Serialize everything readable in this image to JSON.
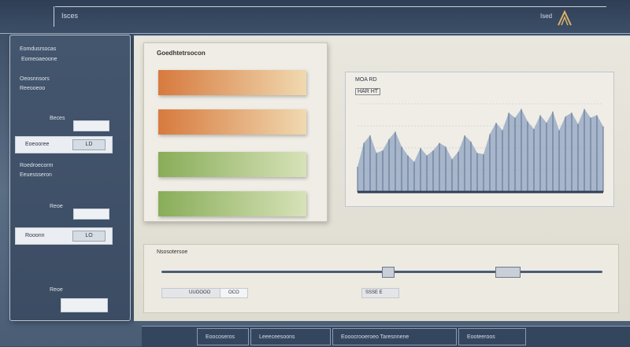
{
  "header": {
    "title": "Isces",
    "user": "Ised"
  },
  "sidebar": {
    "title1": "Eomdusrsocas",
    "title2": "Eomeoaeoone",
    "sub1": "Oeosnnsors",
    "sub2": "Reeooeoo",
    "field1_label": "Beces",
    "row1": {
      "label": "Eoeooree",
      "button": "LD"
    },
    "title3": "Roedroecorm",
    "sub3": "Eeuessseron",
    "field2_label": "Reoe",
    "row2": {
      "label": "Rooonn",
      "button": "LO"
    },
    "field3_label": "Reoe"
  },
  "main": {
    "panel_title": "Goedhtetrsocon",
    "bars": [
      {
        "color": "orange"
      },
      {
        "color": "orange"
      },
      {
        "color": "green"
      },
      {
        "color": "green"
      }
    ],
    "chart_label1": "MOA RD",
    "chart_label2": "HAR HT"
  },
  "lower": {
    "title": "Nsosotersoe",
    "field1": "UUOOOO",
    "field2": "OCO",
    "field3": "SSSE E"
  },
  "footer": {
    "tabs": [
      "Eoocoseros",
      "Leeeceesoons",
      "Eooocrooeroeo Taresnnene",
      "Eooteeroos"
    ]
  },
  "chart_data": {
    "type": "area",
    "x": [
      1,
      2,
      3,
      4,
      5,
      6,
      7,
      8,
      9,
      10,
      11,
      12,
      13,
      14,
      15,
      16,
      17,
      18,
      19,
      20,
      21,
      22,
      23,
      24,
      25,
      26,
      27,
      28,
      29,
      30,
      31,
      32,
      33,
      34,
      35,
      36,
      37,
      38,
      39,
      40
    ],
    "values": [
      40,
      78,
      90,
      62,
      66,
      84,
      96,
      72,
      58,
      48,
      70,
      58,
      66,
      78,
      72,
      52,
      64,
      90,
      80,
      62,
      60,
      92,
      110,
      98,
      126,
      118,
      132,
      112,
      100,
      122,
      110,
      128,
      98,
      120,
      126,
      108,
      132,
      118,
      122,
      104
    ],
    "title": "",
    "xlabel": "",
    "ylabel": "",
    "grid": true,
    "colors": {
      "fill": "#8fa3c0",
      "line": "#5b6f8d"
    }
  }
}
